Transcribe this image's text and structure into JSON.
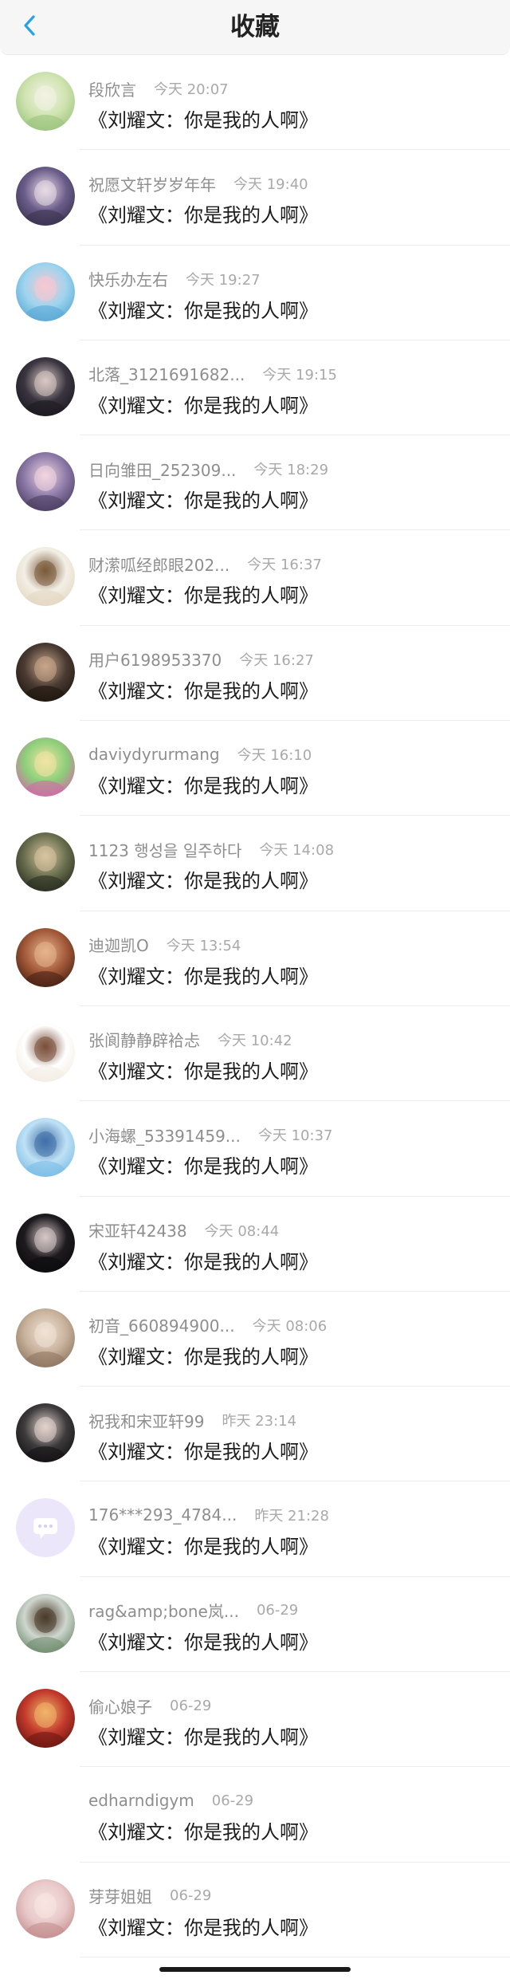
{
  "header": {
    "title": "收藏",
    "back_icon": "chevron-left-icon",
    "accent_color": "#2aa1e6"
  },
  "items": [
    {
      "user": "段欣言",
      "time": "今天 20:07",
      "content": "《刘耀文：你是我的人啊》",
      "avatar_colors": [
        "#cfe3b0",
        "#9dc57e",
        "#f3f2e3"
      ]
    },
    {
      "user": "祝愿文轩岁岁年年",
      "time": "今天 19:40",
      "content": "《刘耀文：你是我的人啊》",
      "avatar_colors": [
        "#6b5d8a",
        "#3b3350",
        "#e8dce6"
      ]
    },
    {
      "user": "快乐办左右",
      "time": "今天 19:27",
      "content": "《刘耀文：你是我的人啊》",
      "avatar_colors": [
        "#9fd4ee",
        "#5aa9d6",
        "#f7c8d2"
      ]
    },
    {
      "user": "北落_3121691682...",
      "time": "今天 19:15",
      "content": "《刘耀文：你是我的人啊》",
      "avatar_colors": [
        "#3a3540",
        "#1c1a20",
        "#d8c9c4"
      ]
    },
    {
      "user": "日向雏田_252309...",
      "time": "今天 18:29",
      "content": "《刘耀文：你是我的人啊》",
      "avatar_colors": [
        "#8d7aa8",
        "#4d3f63",
        "#f1d6e0"
      ]
    },
    {
      "user": "财潆呱经郎眼202...",
      "time": "今天 16:37",
      "content": "《刘耀文：你是我的人啊》",
      "avatar_colors": [
        "#f3efe6",
        "#e4d7c2",
        "#7a5a3a"
      ]
    },
    {
      "user": "用户6198953370",
      "time": "今天 16:27",
      "content": "《刘耀文：你是我的人啊》",
      "avatar_colors": [
        "#4a3b33",
        "#20180f",
        "#c9a68a"
      ]
    },
    {
      "user": "daviydyrurmang",
      "time": "今天 16:10",
      "content": "《刘耀文：你是我的人啊》",
      "avatar_colors": [
        "#8ccf7a",
        "#d06aa6",
        "#f2e4a4"
      ]
    },
    {
      "user": "1123 행성을 일주하다",
      "time": "今天 14:08",
      "content": "《刘耀文：你是我的人啊》",
      "avatar_colors": [
        "#6a6f4f",
        "#2b2e21",
        "#d9c4a0"
      ]
    },
    {
      "user": "迪迦凯O",
      "time": "今天 13:54",
      "content": "《刘耀文：你是我的人啊》",
      "avatar_colors": [
        "#a45a3a",
        "#4a2214",
        "#e6b58d"
      ]
    },
    {
      "user": "张阆静静辟袷忐",
      "time": "今天 10:42",
      "content": "《刘耀文：你是我的人啊》",
      "avatar_colors": [
        "#ffffff",
        "#f3ece4",
        "#7a4f3a"
      ]
    },
    {
      "user": "小海螺_53391459...",
      "time": "今天 10:37",
      "content": "《刘耀文：你是我的人啊》",
      "avatar_colors": [
        "#bfe1f5",
        "#7cbde6",
        "#3f6fa8"
      ]
    },
    {
      "user": "宋亚轩42438",
      "time": "今天 08:44",
      "content": "《刘耀文：你是我的人啊》",
      "avatar_colors": [
        "#1e1b1f",
        "#0c0b0d",
        "#d6c7c6"
      ]
    },
    {
      "user": "初音_660894900...",
      "time": "今天 08:06",
      "content": "《刘耀文：你是我的人啊》",
      "avatar_colors": [
        "#c8b29c",
        "#8f7662",
        "#f0e2d5"
      ]
    },
    {
      "user": "祝我和宋亚轩99",
      "time": "昨天 23:14",
      "content": "《刘耀文：你是我的人啊》",
      "avatar_colors": [
        "#3d3b3c",
        "#141314",
        "#e3d3cd"
      ]
    },
    {
      "user": "176***293_4784...",
      "time": "昨天 21:28",
      "content": "《刘耀文：你是我的人啊》",
      "avatar_colors": [
        "#ece6fb",
        "#d8cdf6",
        "#ffffff"
      ]
    },
    {
      "user": "rag&amp;bone岚...",
      "time": "06-29",
      "content": "《刘耀文：你是我的人啊》",
      "avatar_colors": [
        "#cfd7cf",
        "#6f8c6e",
        "#4b3a2a"
      ]
    },
    {
      "user": "偷心娘子",
      "time": "06-29",
      "content": "《刘耀文：你是我的人啊》",
      "avatar_colors": [
        "#c23a2c",
        "#6e1712",
        "#f1b46a"
      ]
    },
    {
      "user": "edharndigym",
      "time": "06-29",
      "content": "《刘耀文：你是我的人啊》",
      "avatar_colors": [
        "#ffffff",
        "#ffffff",
        "#ffffff"
      ]
    },
    {
      "user": "芽芽姐姐",
      "time": "06-29",
      "content": "《刘耀文：你是我的人啊》",
      "avatar_colors": [
        "#e8c8c8",
        "#c58f8f",
        "#f7e6e2"
      ]
    }
  ]
}
